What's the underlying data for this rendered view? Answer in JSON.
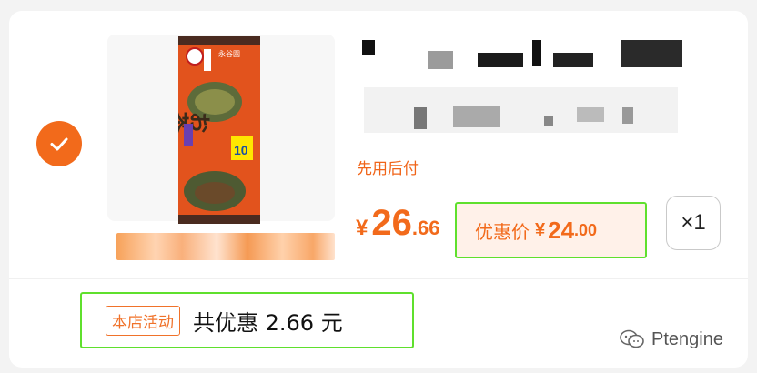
{
  "cart_item": {
    "selected": true,
    "product_image_alt": "お茶漬亭",
    "product_pack_text": {
      "brand_vertical": "永谷園",
      "main_title": "お茶漬亭",
      "count": "10"
    },
    "pay_later_label": "先用后付",
    "price": {
      "currency": "¥",
      "integer": "26",
      "decimal": ".66"
    },
    "promo": {
      "label": "优惠价",
      "currency": "¥",
      "integer": "24",
      "decimal": ".00"
    },
    "quantity": "×1"
  },
  "store_activity": {
    "tag": "本店活动",
    "text": "共优惠 2.66 元"
  },
  "watermark": {
    "brand": "Ptengine"
  },
  "colors": {
    "accent": "#f26a1b",
    "highlight_outline": "#5fe02d",
    "promo_bg": "#fff1e9"
  },
  "icons": {
    "check": "check-icon",
    "watermark": "wechat-icon"
  }
}
